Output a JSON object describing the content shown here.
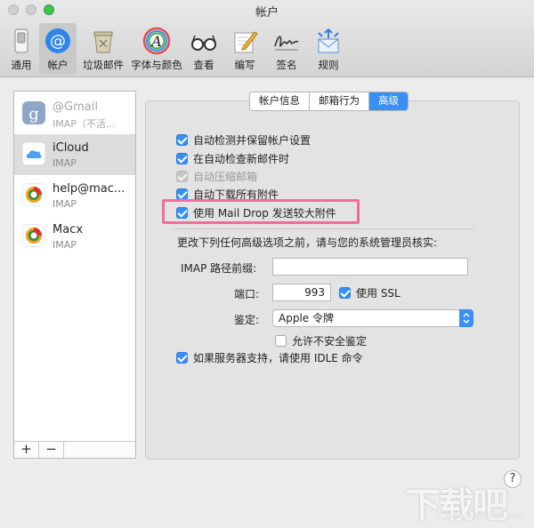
{
  "window": {
    "title": "帐户"
  },
  "toolbar": {
    "items": [
      {
        "label": "通用",
        "icon": "general-switch-icon",
        "active": false
      },
      {
        "label": "帐户",
        "icon": "at-sign-icon",
        "active": true
      },
      {
        "label": "垃圾邮件",
        "icon": "junk-bin-icon",
        "active": false
      },
      {
        "label": "字体与颜色",
        "icon": "font-color-icon",
        "active": false
      },
      {
        "label": "查看",
        "icon": "glasses-icon",
        "active": false
      },
      {
        "label": "编写",
        "icon": "compose-pencil-icon",
        "active": false
      },
      {
        "label": "签名",
        "icon": "signature-icon",
        "active": false
      },
      {
        "label": "规则",
        "icon": "rules-envelope-icon",
        "active": false
      }
    ]
  },
  "accounts": [
    {
      "name": "@Gmail",
      "type": "IMAP（不活...",
      "icon": "google-icon",
      "disabled": true,
      "selected": false
    },
    {
      "name": "iCloud",
      "type": "IMAP",
      "icon": "icloud-icon",
      "disabled": false,
      "selected": true
    },
    {
      "name": "help@mac...",
      "type": "IMAP",
      "icon": "mail-account-icon",
      "disabled": false,
      "selected": false
    },
    {
      "name": "Macx",
      "type": "IMAP",
      "icon": "mail-account-icon",
      "disabled": false,
      "selected": false
    }
  ],
  "sidebar_buttons": {
    "add": "+",
    "remove": "−"
  },
  "tabs": [
    {
      "label": "帐户信息",
      "active": false
    },
    {
      "label": "邮箱行为",
      "active": false
    },
    {
      "label": "高级",
      "active": true
    }
  ],
  "advanced": {
    "options": [
      {
        "label": "自动检测并保留帐户设置",
        "state": "on"
      },
      {
        "label": "在自动检查新邮件时",
        "state": "on"
      },
      {
        "label": "自动压缩邮箱",
        "state": "dim"
      },
      {
        "label": "自动下载所有附件",
        "state": "on"
      },
      {
        "label": "使用 Mail Drop 发送较大附件",
        "state": "on"
      }
    ],
    "admin_note": "更改下列任何高级选项之前，请与您的系统管理员核实:",
    "imap_prefix_label": "IMAP 路径前缀:",
    "imap_prefix_value": "",
    "port_label": "端口:",
    "port_value": "993",
    "use_ssl_label": "使用 SSL",
    "auth_label": "鉴定:",
    "auth_value": "Apple 令牌",
    "allow_insecure_label": "允许不安全鉴定",
    "idle_label": "如果服务器支持，请使用 IDLE 命令"
  },
  "help": {
    "label": "?"
  },
  "watermark": {
    "text": "下载吧",
    "sub": "www.xiazaiba.com"
  },
  "colors": {
    "accent": "#3a8ff5",
    "highlight": "#f36b9c"
  }
}
